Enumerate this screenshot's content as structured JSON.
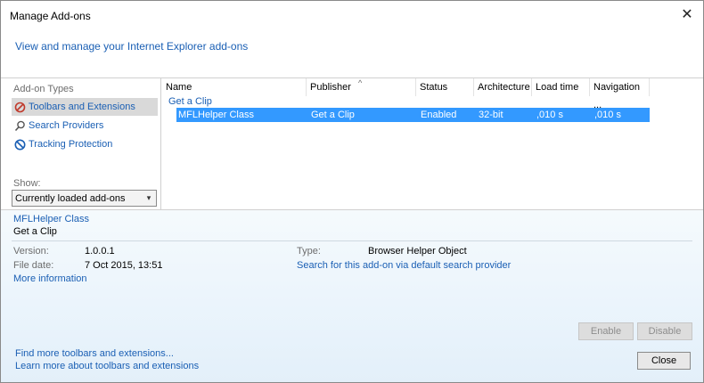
{
  "window": {
    "title": "Manage Add-ons"
  },
  "header": {
    "link": "View and manage your Internet Explorer add-ons"
  },
  "left": {
    "heading": "Add-on Types",
    "types": [
      {
        "label": "Toolbars and Extensions",
        "icon": "toolbar-icon"
      },
      {
        "label": "Search Providers",
        "icon": "search-icon"
      },
      {
        "label": "Tracking Protection",
        "icon": "tracking-icon"
      }
    ],
    "show_label": "Show:",
    "show_value": "Currently loaded add-ons"
  },
  "list": {
    "columns": [
      "Name",
      "Publisher",
      "Status",
      "Architecture",
      "Load time",
      "Navigation ..."
    ],
    "group": "Get a Clip",
    "row": {
      "name": "MFLHelper Class",
      "publisher": "Get a Clip",
      "status": "Enabled",
      "architecture": "32-bit",
      "load_time": ",010 s",
      "navigation": ",010 s"
    }
  },
  "detail": {
    "name": "MFLHelper Class",
    "publisher": "Get a Clip",
    "version_label": "Version:",
    "version": "1.0.0.1",
    "filedate_label": "File date:",
    "filedate": "7 Oct 2015, 13:51",
    "more_info": "More information",
    "type_label": "Type:",
    "type_value": "Browser Helper Object",
    "search_link": "Search for this add-on via default search provider",
    "enable": "Enable",
    "disable": "Disable"
  },
  "footer": {
    "link1": "Find more toolbars and extensions...",
    "link2": "Learn more about toolbars and extensions",
    "close": "Close"
  }
}
